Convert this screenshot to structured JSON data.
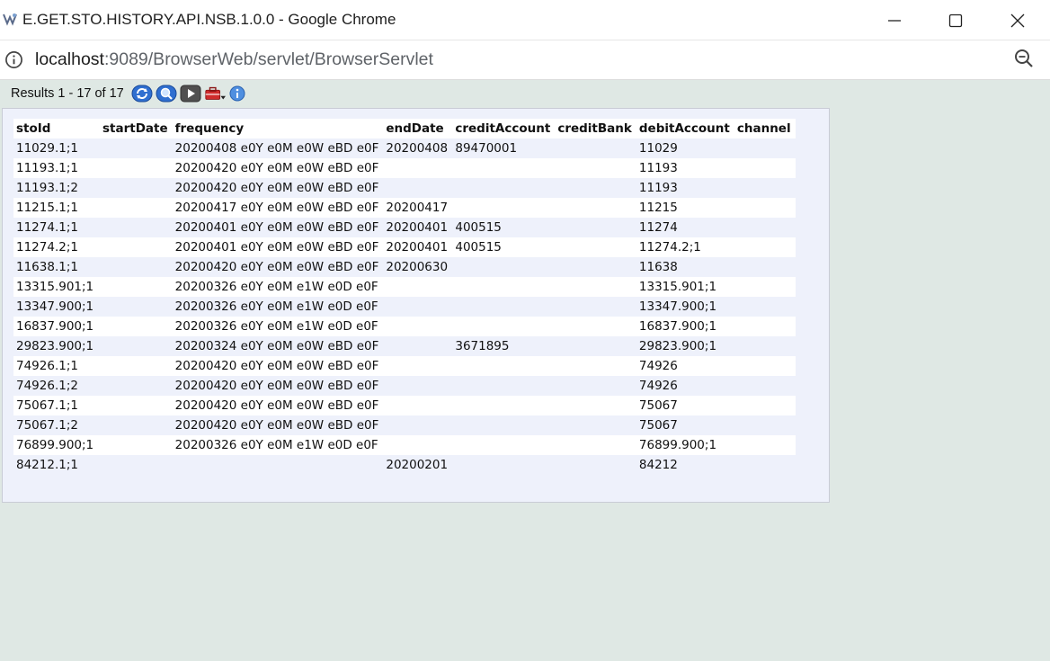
{
  "window": {
    "title": "E.GET.STO.HISTORY.API.NSB.1.0.0 - Google Chrome"
  },
  "address": {
    "host": "localhost",
    "path": ":9089/BrowserWeb/servlet/BrowserServlet"
  },
  "toolbar": {
    "results_text": "Results 1 - 17 of 17",
    "icons": [
      "refresh-icon",
      "search-icon",
      "next-icon",
      "toolbox-icon",
      "info-icon"
    ]
  },
  "table": {
    "columns": [
      "stoId",
      "startDate",
      "frequency",
      "endDate",
      "creditAccount",
      "creditBank",
      "debitAccount",
      "channel"
    ],
    "rows": [
      [
        "11029.1;1",
        "",
        "20200408 e0Y e0M e0W eBD e0F",
        "20200408",
        "89470001",
        "",
        "11029",
        ""
      ],
      [
        "11193.1;1",
        "",
        "20200420 e0Y e0M e0W eBD e0F",
        "",
        "",
        "",
        "11193",
        ""
      ],
      [
        "11193.1;2",
        "",
        "20200420 e0Y e0M e0W eBD e0F",
        "",
        "",
        "",
        "11193",
        ""
      ],
      [
        "11215.1;1",
        "",
        "20200417 e0Y e0M e0W eBD e0F",
        "20200417",
        "",
        "",
        "11215",
        ""
      ],
      [
        "11274.1;1",
        "",
        "20200401 e0Y e0M e0W eBD e0F",
        "20200401",
        "400515",
        "",
        "11274",
        ""
      ],
      [
        "11274.2;1",
        "",
        "20200401 e0Y e0M e0W eBD e0F",
        "20200401",
        "400515",
        "",
        "11274.2;1",
        ""
      ],
      [
        "11638.1;1",
        "",
        "20200420 e0Y e0M e0W eBD e0F",
        "20200630",
        "",
        "",
        "11638",
        ""
      ],
      [
        "13315.901;1",
        "",
        "20200326 e0Y e0M e1W e0D e0F",
        "",
        "",
        "",
        "13315.901;1",
        ""
      ],
      [
        "13347.900;1",
        "",
        "20200326 e0Y e0M e1W e0D e0F",
        "",
        "",
        "",
        "13347.900;1",
        ""
      ],
      [
        "16837.900;1",
        "",
        "20200326 e0Y e0M e1W e0D e0F",
        "",
        "",
        "",
        "16837.900;1",
        ""
      ],
      [
        "29823.900;1",
        "",
        "20200324 e0Y e0M e0W eBD e0F",
        "",
        "3671895",
        "",
        "29823.900;1",
        ""
      ],
      [
        "74926.1;1",
        "",
        "20200420 e0Y e0M e0W eBD e0F",
        "",
        "",
        "",
        "74926",
        ""
      ],
      [
        "74926.1;2",
        "",
        "20200420 e0Y e0M e0W eBD e0F",
        "",
        "",
        "",
        "74926",
        ""
      ],
      [
        "75067.1;1",
        "",
        "20200420 e0Y e0M e0W eBD e0F",
        "",
        "",
        "",
        "75067",
        ""
      ],
      [
        "75067.1;2",
        "",
        "20200420 e0Y e0M e0W eBD e0F",
        "",
        "",
        "",
        "75067",
        ""
      ],
      [
        "76899.900;1",
        "",
        "20200326 e0Y e0M e1W e0D e0F",
        "",
        "",
        "",
        "76899.900;1",
        ""
      ],
      [
        "84212.1;1",
        "",
        "",
        "20200201",
        "",
        "",
        "84212",
        ""
      ]
    ]
  }
}
